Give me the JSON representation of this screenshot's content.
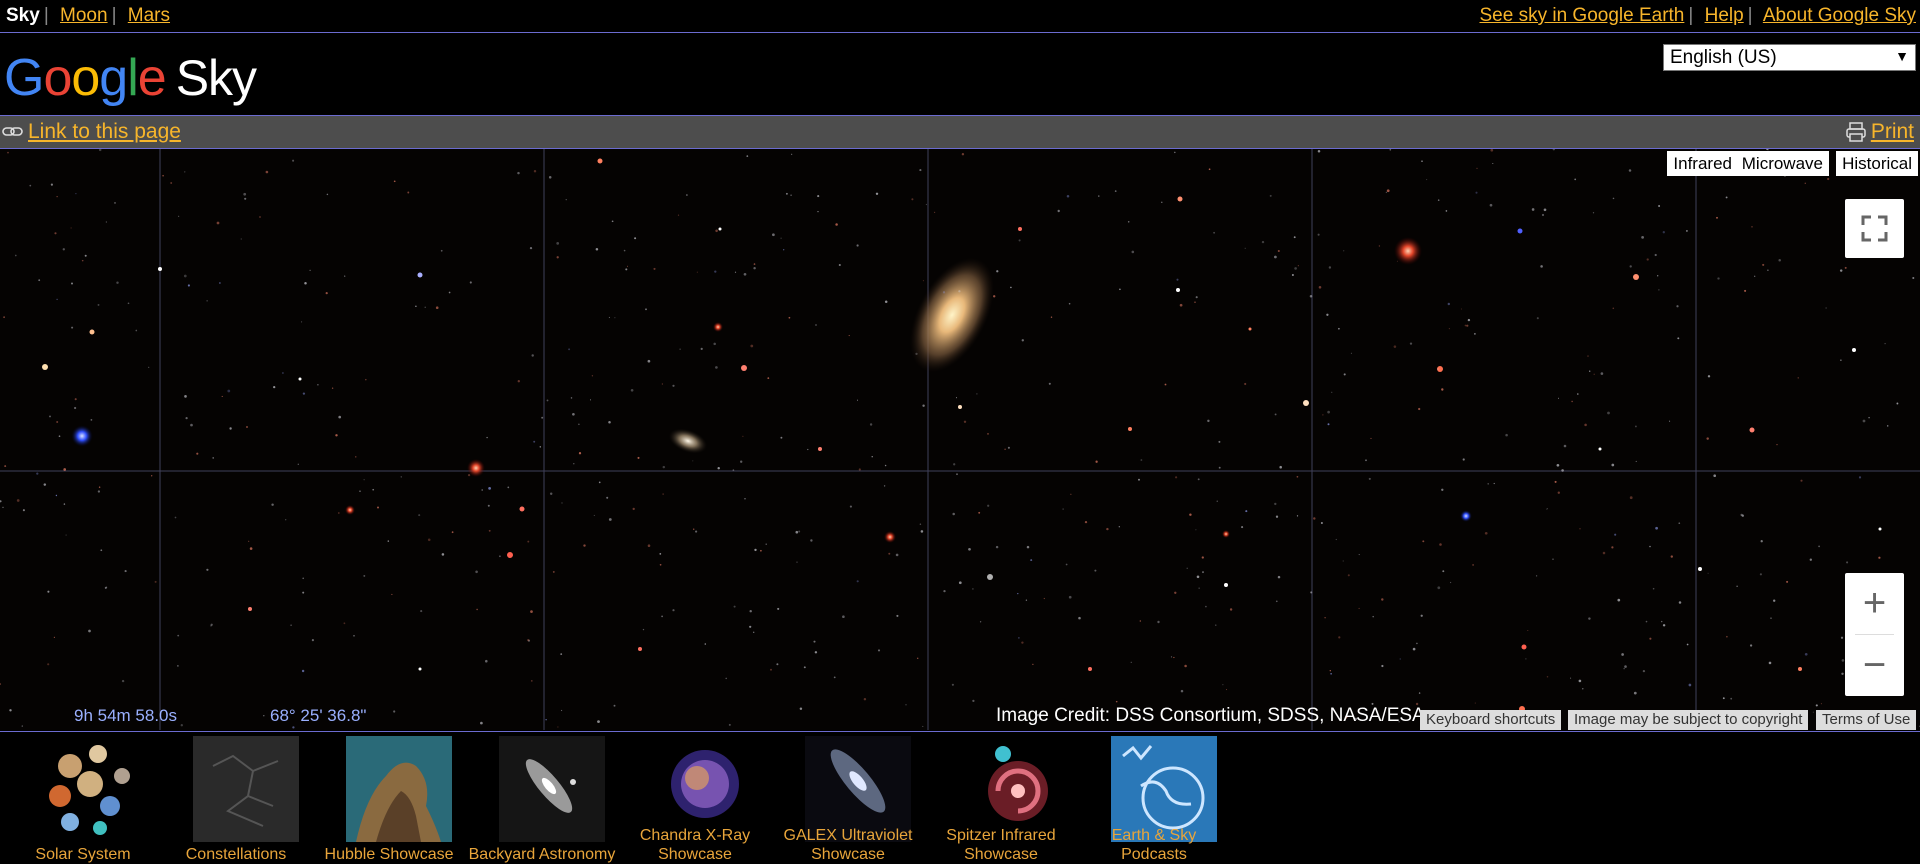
{
  "topnav": {
    "current": "Sky",
    "moon": "Moon",
    "mars": "Mars",
    "earth_link": "See sky in Google Earth",
    "help": "Help",
    "about": "About Google Sky"
  },
  "header": {
    "logo_google": [
      "G",
      "o",
      "o",
      "g",
      "l",
      "e"
    ],
    "logo_product": "Sky",
    "language": "English (US)"
  },
  "linkbar": {
    "link_page": "Link to this page",
    "print": "Print"
  },
  "map": {
    "layers": [
      "Infrared",
      "Microwave",
      "Historical"
    ],
    "ra": "9h 54m 58.0s",
    "dec": "68° 25' 36.8\"",
    "credit": "Image Credit: DSS Consortium, SDSS, NASA/ESA",
    "footer_buttons": [
      "Keyboard shortcuts",
      "Image may be subject to copyright",
      "Terms of Use"
    ],
    "zoom_in": "+",
    "zoom_out": "−"
  },
  "showcase": [
    {
      "label": "Solar System"
    },
    {
      "label": "Constellations"
    },
    {
      "label": "Hubble Showcase"
    },
    {
      "label": "Backyard Astronomy"
    },
    {
      "label": "Chandra X-Ray Showcase"
    },
    {
      "label": "GALEX Ultraviolet Showcase"
    },
    {
      "label": "Spitzer Infrared Showcase"
    },
    {
      "label": "Earth & Sky Podcasts"
    }
  ],
  "colors": {
    "link": "#f7b52b",
    "showcase_label": "#e8a53b",
    "coordinate_text": "#9ab0ff",
    "divider": "#6b6bd0"
  }
}
